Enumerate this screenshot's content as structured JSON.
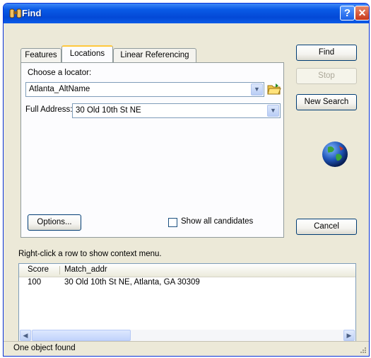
{
  "window": {
    "title": "Find"
  },
  "tabs": [
    {
      "label": "Features"
    },
    {
      "label": "Locations"
    },
    {
      "label": "Linear Referencing"
    }
  ],
  "locator": {
    "label": "Choose a locator:",
    "value": "Atlanta_AltName"
  },
  "address": {
    "label": "Full Address:",
    "value": "30 Old 10th St NE"
  },
  "options_label": "Options...",
  "show_all_label": "Show all candidates",
  "buttons": {
    "find": "Find",
    "stop": "Stop",
    "new_search": "New Search",
    "cancel": "Cancel"
  },
  "hint": "Right-click a row to show context menu.",
  "results": {
    "columns": [
      "Score",
      "Match_addr"
    ],
    "rows": [
      {
        "score": "100",
        "match_addr": "30 Old 10th St NE, Atlanta, GA 30309"
      }
    ]
  },
  "status": "One object found",
  "icons": {
    "title": "binoculars-icon",
    "help": "help-icon",
    "close": "close-icon",
    "browse": "open-folder-icon",
    "globe": "globe-icon",
    "dropdown": "chevron-down-icon"
  },
  "colors": {
    "titlebar": "#0349d6",
    "dialog": "#ece9d8",
    "active_tab": "#ffc83c"
  }
}
